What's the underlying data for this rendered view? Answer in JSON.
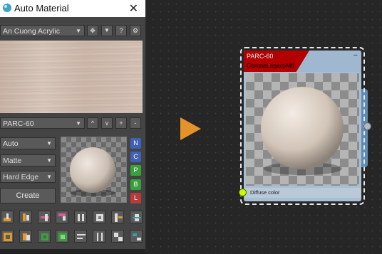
{
  "window": {
    "title": "Auto Material",
    "close_label": "✕"
  },
  "toolbar": {
    "library_selected": "An Cuong Acrylic",
    "icons": [
      "move-icon",
      "heart-icon",
      "help-icon",
      "settings-icon"
    ],
    "help_label": "?",
    "heart_label": "♥",
    "move_label": "✥",
    "settings_label": "⚙"
  },
  "material_nav": {
    "selected": "PARC-60",
    "buttons": [
      "^",
      "v",
      "+",
      "-"
    ]
  },
  "options": {
    "mapping": "Auto",
    "finish": "Matte",
    "edge": "Hard Edge",
    "create_label": "Create"
  },
  "channels": [
    {
      "label": "N",
      "color": "#3f62b8"
    },
    {
      "label": "C",
      "color": "#3f62b8"
    },
    {
      "label": "P",
      "color": "#39a13b"
    },
    {
      "label": "B",
      "color": "#39a13b"
    },
    {
      "label": "L",
      "color": "#b83a3a"
    }
  ],
  "node": {
    "title": "PARC-60",
    "subtitle": "CoronaLegacyMtl",
    "minimize_label": "−",
    "input_label": "Diffuse color"
  },
  "colors": {
    "accent_play": "#e6922a",
    "node_header_red": "#b30000",
    "socket_input": "#c8ff00"
  }
}
